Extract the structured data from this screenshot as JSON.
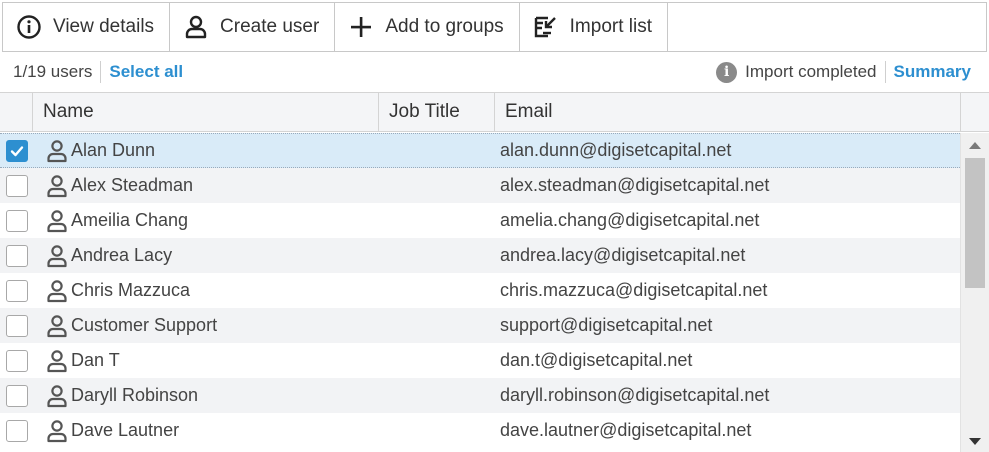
{
  "toolbar": {
    "view_details": "View details",
    "create_user": "Create user",
    "add_to_groups": "Add to groups",
    "import_list": "Import list"
  },
  "infobar": {
    "count": "1/19 users",
    "select_all": "Select all",
    "status": "Import completed",
    "summary": "Summary"
  },
  "columns": {
    "name": "Name",
    "job_title": "Job Title",
    "email": "Email"
  },
  "users": [
    {
      "name": "Alan Dunn",
      "email": "alan.dunn@digisetcapital.net",
      "checked": true
    },
    {
      "name": "Alex Steadman",
      "email": "alex.steadman@digisetcapital.net",
      "checked": false
    },
    {
      "name": "Ameilia Chang",
      "email": "amelia.chang@digisetcapital.net",
      "checked": false
    },
    {
      "name": "Andrea Lacy",
      "email": "andrea.lacy@digisetcapital.net",
      "checked": false
    },
    {
      "name": "Chris Mazzuca",
      "email": "chris.mazzuca@digisetcapital.net",
      "checked": false
    },
    {
      "name": "Customer Support",
      "email": "support@digisetcapital.net",
      "checked": false
    },
    {
      "name": "Dan T",
      "email": "dan.t@digisetcapital.net",
      "checked": false
    },
    {
      "name": "Daryll Robinson",
      "email": "daryll.robinson@digisetcapital.net",
      "checked": false
    },
    {
      "name": "Dave Lautner",
      "email": "dave.lautner@digisetcapital.net",
      "checked": false
    }
  ],
  "colors": {
    "accent": "#2d8fd0",
    "selected_row": "#d9ebf8"
  },
  "icons": {
    "view_details": "info-circle-icon",
    "create_user": "user-icon",
    "add_to_groups": "plus-icon",
    "import_list": "import-icon",
    "status": "info-icon",
    "row_user": "user-icon"
  }
}
